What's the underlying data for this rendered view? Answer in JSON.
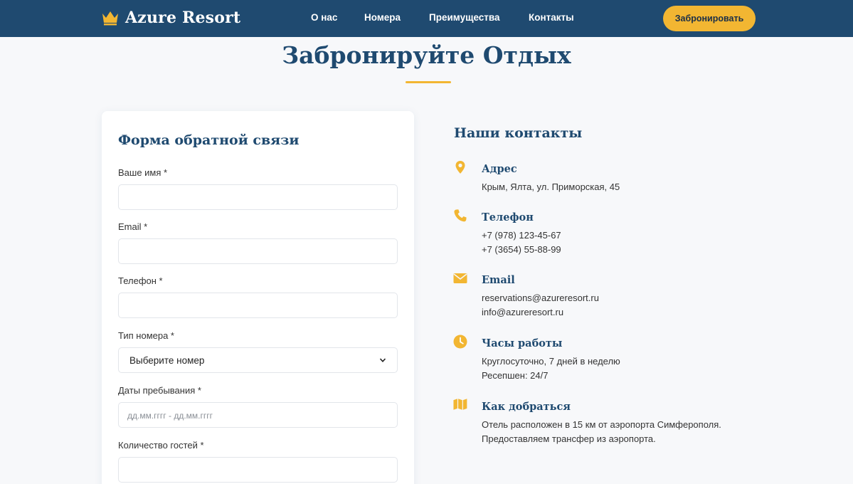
{
  "header": {
    "logo_text": "Azure Resort",
    "logo_icon": "crown-icon",
    "nav": [
      "О нас",
      "Номера",
      "Преимущества",
      "Контакты"
    ],
    "book_button": "Забронировать"
  },
  "main": {
    "title": "Забронируйте Отдых"
  },
  "form": {
    "title": "Форма обратной связи",
    "name_label": "Ваше имя *",
    "name_value": "",
    "email_label": "Email *",
    "email_value": "",
    "phone_label": "Телефон *",
    "phone_value": "",
    "room_label": "Тип номера *",
    "room_selected": "Выберите номер",
    "dates_label": "Даты пребывания *",
    "dates_placeholder": "дд.мм.гггг - дд.мм.гггг",
    "guests_label": "Количество гостей *",
    "guests_value": ""
  },
  "contacts": {
    "title": "Наши контакты",
    "address": {
      "heading": "Адрес",
      "icon": "map-pin-icon",
      "lines": [
        "Крым, Ялта, ул. Приморская, 45"
      ]
    },
    "phone": {
      "heading": "Телефон",
      "icon": "phone-icon",
      "lines": [
        "+7 (978) 123-45-67",
        "+7 (3654) 55-88-99"
      ]
    },
    "email": {
      "heading": "Email",
      "icon": "envelope-icon",
      "lines": [
        "reservations@azureresort.ru",
        "info@azureresort.ru"
      ]
    },
    "hours": {
      "heading": "Часы работы",
      "icon": "clock-icon",
      "lines": [
        "Круглосуточно, 7 дней в неделю",
        "Ресепшен: 24/7"
      ]
    },
    "directions": {
      "heading": "Как добраться",
      "icon": "map-icon",
      "lines": [
        "Отель расположен в 15 км от аэропорта Симферополя.",
        "Предоставляем трансфер из аэропорта."
      ]
    }
  },
  "colors": {
    "header_bg": "#1f4a70",
    "accent": "#f2b632",
    "heading": "#1f4a70"
  }
}
